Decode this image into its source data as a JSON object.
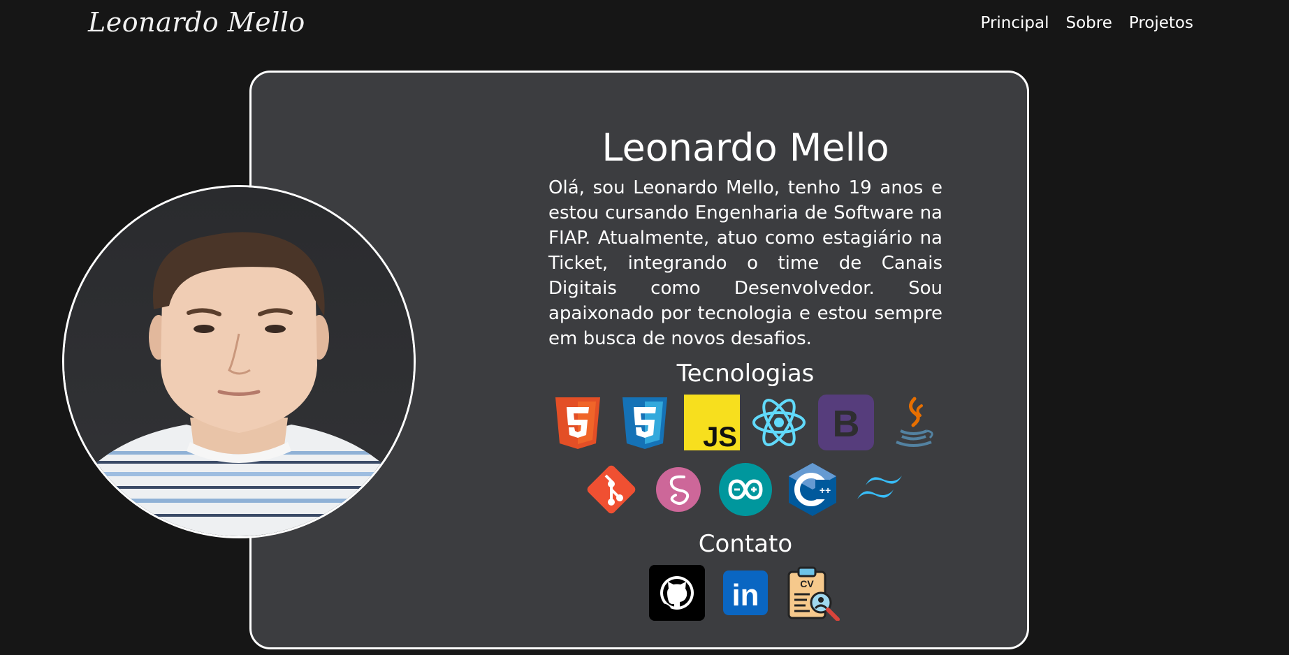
{
  "header": {
    "brand": "Leonardo Mello",
    "nav": [
      {
        "label": "Principal"
      },
      {
        "label": "Sobre"
      },
      {
        "label": "Projetos"
      }
    ]
  },
  "profile": {
    "name": "Leonardo Mello",
    "bio": "Olá, sou Leonardo Mello, tenho 19 anos e estou cursando Engenharia de Software na FIAP. Atualmente, atuo como estagiário na Ticket, integrando o time de Canais Digitais como Desenvolvedor. Sou apaixonado por tecnologia e estou sempre em busca de novos desafios.",
    "photo_icon": "profile-photo"
  },
  "technologies": {
    "title": "Tecnologias",
    "items": [
      {
        "icon": "html5-icon"
      },
      {
        "icon": "css3-icon"
      },
      {
        "icon": "javascript-icon",
        "text": "JS"
      },
      {
        "icon": "react-icon"
      },
      {
        "icon": "bootstrap-icon",
        "text": "B"
      },
      {
        "icon": "java-icon"
      },
      {
        "icon": "git-icon"
      },
      {
        "icon": "sass-icon"
      },
      {
        "icon": "arduino-icon"
      },
      {
        "icon": "cplusplus-icon",
        "text": "++"
      },
      {
        "icon": "tailwind-icon"
      }
    ]
  },
  "contact": {
    "title": "Contato",
    "items": [
      {
        "icon": "github-icon"
      },
      {
        "icon": "linkedin-icon",
        "text": "in"
      },
      {
        "icon": "cv-icon",
        "text": "CV"
      }
    ]
  },
  "colors": {
    "background": "#161616",
    "card": "#3c3d40",
    "border": "#ffffff",
    "html5": "#e34f26",
    "css3": "#1572b6",
    "javascript": "#f7df1e",
    "react": "#61dafb",
    "bootstrap": "#563d7c",
    "java": "#e76f00",
    "git": "#f05032",
    "sass": "#cd6799",
    "arduino": "#00979d",
    "cplusplus": "#00599c",
    "tailwind": "#38bdf8",
    "linkedin": "#0a66c2"
  }
}
